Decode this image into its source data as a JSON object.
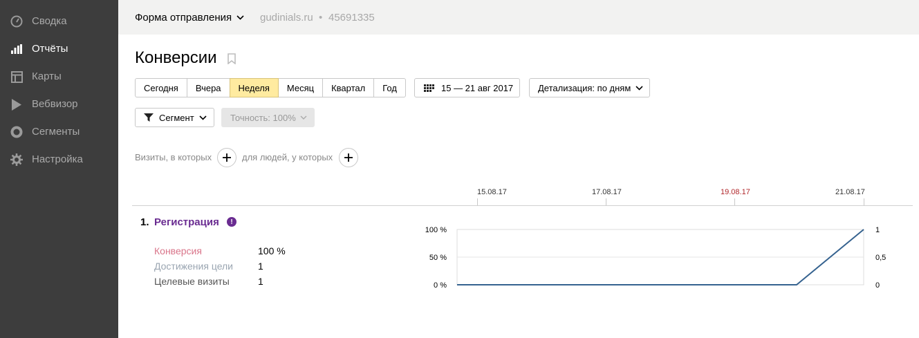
{
  "sidebar": {
    "items": [
      {
        "label": "Сводка",
        "icon": "gauge-icon",
        "active": false
      },
      {
        "label": "Отчёты",
        "icon": "bar-chart-icon",
        "active": true
      },
      {
        "label": "Карты",
        "icon": "map-layout-icon",
        "active": false
      },
      {
        "label": "Вебвизор",
        "icon": "play-icon",
        "active": false
      },
      {
        "label": "Сегменты",
        "icon": "donut-icon",
        "active": false
      },
      {
        "label": "Настройка",
        "icon": "gear-icon",
        "active": false
      }
    ]
  },
  "header": {
    "counter_name": "Форма отправления",
    "site": "gudinials.ru",
    "separator": "•",
    "counter_id": "45691335"
  },
  "page": {
    "title": "Конверсии"
  },
  "period": {
    "buttons": [
      "Сегодня",
      "Вчера",
      "Неделя",
      "Месяц",
      "Квартал",
      "Год"
    ],
    "active": "Неделя",
    "date_range": "15 — 21 авг 2017",
    "detail_label": "Детализация: по дням"
  },
  "filters": {
    "segment_label": "Сегмент",
    "accuracy_label": "Точность: 100%",
    "visits_label": "Визиты, в которых",
    "people_label": "для людей, у которых"
  },
  "timeline": {
    "labels": [
      {
        "text": "15.08.17",
        "weekend": false
      },
      {
        "text": "17.08.17",
        "weekend": false
      },
      {
        "text": "19.08.17",
        "weekend": true
      },
      {
        "text": "21.08.17",
        "weekend": false
      }
    ]
  },
  "goal": {
    "number": "1.",
    "name": "Регистрация",
    "warn": "!",
    "metrics": [
      {
        "label": "Конверсия",
        "value": "100 %",
        "color": "#d9758a"
      },
      {
        "label": "Достижения цели",
        "value": "1",
        "color": "#9aa5b1"
      },
      {
        "label": "Целевые визиты",
        "value": "1",
        "color": "#555555"
      }
    ]
  },
  "chart_data": {
    "type": "line",
    "x": [
      "15.08.17",
      "16.08.17",
      "17.08.17",
      "18.08.17",
      "19.08.17",
      "20.08.17",
      "21.08.17"
    ],
    "series": [
      {
        "values": [
          0,
          0,
          0,
          0,
          0,
          0,
          100
        ]
      }
    ],
    "left_ticks": [
      "100 %",
      "50 %",
      "0 %"
    ],
    "right_ticks": [
      "1",
      "0,5",
      "0"
    ],
    "ylim": [
      0,
      100
    ],
    "line_color": "#35628f",
    "grid": true
  }
}
